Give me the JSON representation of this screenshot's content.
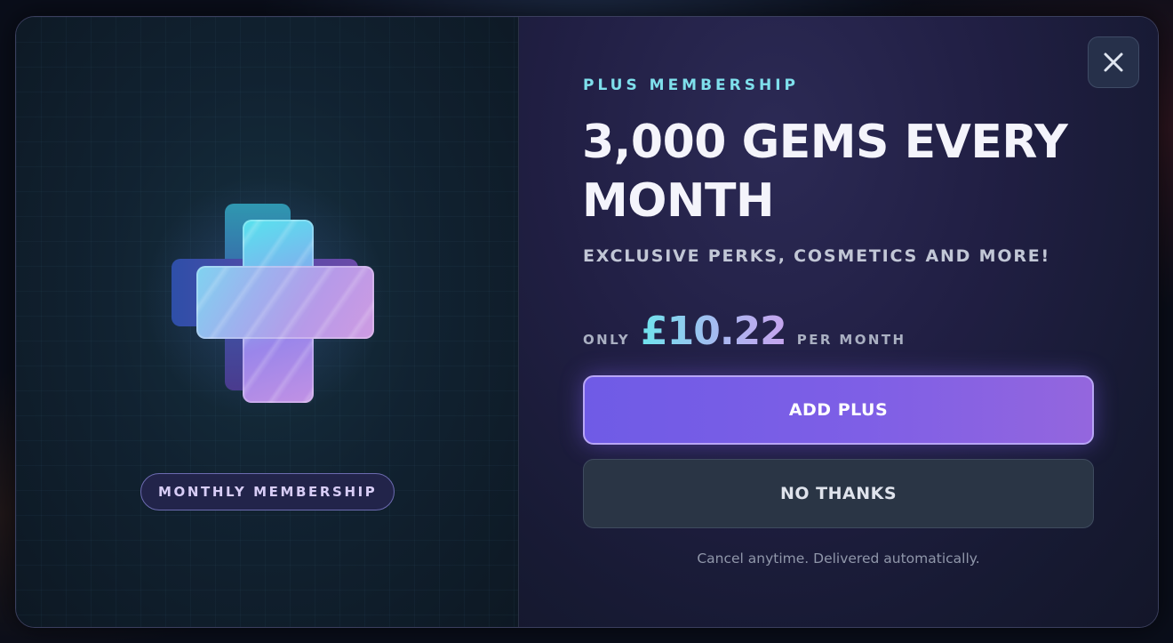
{
  "modal": {
    "left_panel": {
      "icon": "plus-gem-icon",
      "badge_label": "MONTHLY MEMBERSHIP"
    },
    "right_panel": {
      "close_icon": "close-icon",
      "eyebrow": "PLUS MEMBERSHIP",
      "headline": "3,000 GEMS EVERY MONTH",
      "subheadline": "EXCLUSIVE PERKS, COSMETICS AND MORE!",
      "price": {
        "prefix": "ONLY",
        "amount": "£10.22",
        "suffix": "PER MONTH"
      },
      "primary_button_label": "ADD PLUS",
      "secondary_button_label": "NO THANKS",
      "footnote": "Cancel anytime. Delivered automatically."
    }
  },
  "colors": {
    "accent_cyan": "#7fe0ec",
    "primary_button": "#7e5fe6",
    "secondary_button": "#2a3545",
    "modal_background": "#211f44"
  }
}
